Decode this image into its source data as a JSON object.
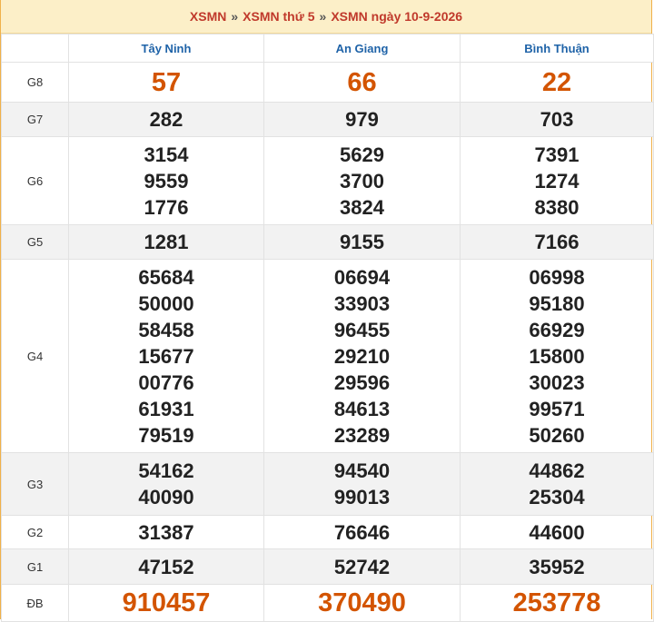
{
  "header": {
    "crumb1": "XSMN",
    "crumb2": "XSMN thứ 5",
    "crumb3": "XSMN ngày 10-9-2026",
    "separator": "»"
  },
  "provinces": [
    "Tây Ninh",
    "An Giang",
    "Bình Thuận"
  ],
  "prizes": [
    {
      "label": "G8",
      "values": [
        [
          "57"
        ],
        [
          "66"
        ],
        [
          "22"
        ]
      ]
    },
    {
      "label": "G7",
      "values": [
        [
          "282"
        ],
        [
          "979"
        ],
        [
          "703"
        ]
      ]
    },
    {
      "label": "G6",
      "values": [
        [
          "3154",
          "9559",
          "1776"
        ],
        [
          "5629",
          "3700",
          "3824"
        ],
        [
          "7391",
          "1274",
          "8380"
        ]
      ]
    },
    {
      "label": "G5",
      "values": [
        [
          "1281"
        ],
        [
          "9155"
        ],
        [
          "7166"
        ]
      ]
    },
    {
      "label": "G4",
      "values": [
        [
          "65684",
          "50000",
          "58458",
          "15677",
          "00776",
          "61931",
          "79519"
        ],
        [
          "06694",
          "33903",
          "96455",
          "29210",
          "29596",
          "84613",
          "23289"
        ],
        [
          "06998",
          "95180",
          "66929",
          "15800",
          "30023",
          "99571",
          "50260"
        ]
      ]
    },
    {
      "label": "G3",
      "values": [
        [
          "54162",
          "40090"
        ],
        [
          "94540",
          "99013"
        ],
        [
          "44862",
          "25304"
        ]
      ]
    },
    {
      "label": "G2",
      "values": [
        [
          "31387"
        ],
        [
          "76646"
        ],
        [
          "44600"
        ]
      ]
    },
    {
      "label": "G1",
      "values": [
        [
          "47152"
        ],
        [
          "52742"
        ],
        [
          "35952"
        ]
      ]
    },
    {
      "label": "ĐB",
      "values": [
        [
          "910457"
        ],
        [
          "370490"
        ],
        [
          "253778"
        ]
      ]
    }
  ],
  "colors": {
    "accent_red": "#c0392b",
    "highlight_orange": "#d35400",
    "province_blue": "#1f63a8",
    "header_bg": "#fcefc8"
  }
}
